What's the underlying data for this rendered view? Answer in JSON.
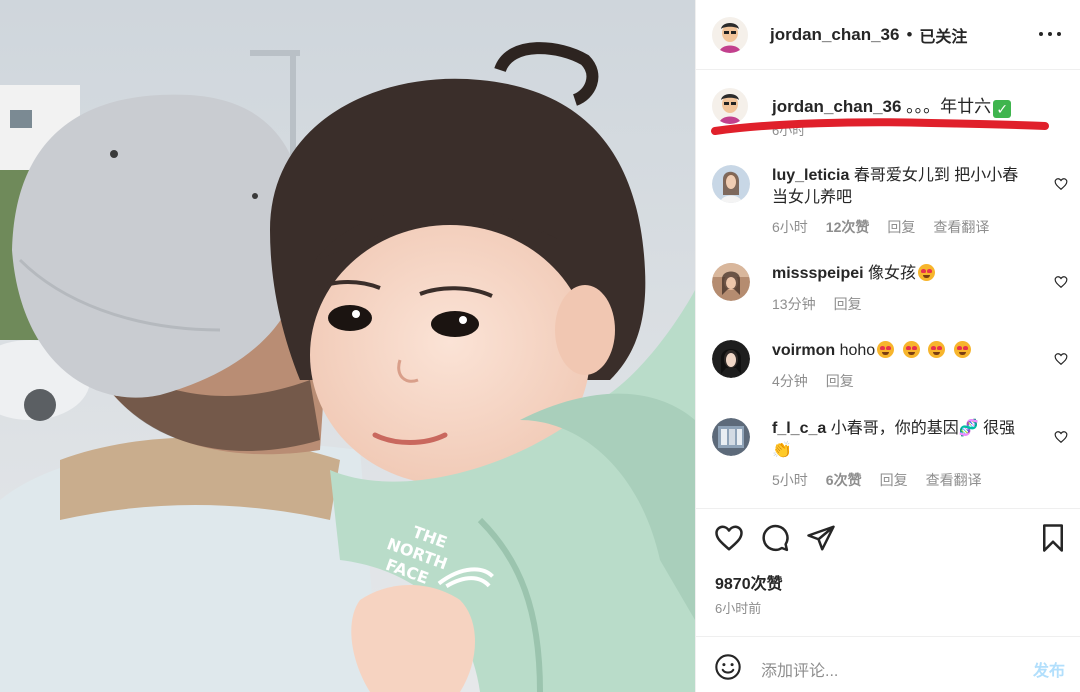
{
  "post": {
    "username": "jordan_chan_36",
    "separator": "•",
    "follow_status": "已关注",
    "more_icon": "more-horizontal-icon"
  },
  "caption": {
    "username": "jordan_chan_36",
    "text": " 。。。年廿六",
    "emoji": "check-mark-emoji",
    "time": "6小时"
  },
  "comments": [
    {
      "username": "luy_leticia",
      "text": " 春哥爱女儿到 把小小春当女儿养吧",
      "time": "6小时",
      "likes": "12次赞",
      "reply": "回复",
      "translate": "查看翻译"
    },
    {
      "username": "missspeipei",
      "text": " 像女孩",
      "time": "13分钟",
      "reply": "回复"
    },
    {
      "username": "voirmon",
      "text": " hoho",
      "time": "4分钟",
      "reply": "回复"
    },
    {
      "username": "f_l_c_a",
      "text": " 小春哥，你的基因",
      "text2": " 很强",
      "time": "5小时",
      "likes": "6次赞",
      "reply": "回复",
      "translate": "查看翻译"
    }
  ],
  "stats": {
    "likes": "9870次赞",
    "posted": "6小时前"
  },
  "add_comment": {
    "placeholder": "添加评论...",
    "post_label": "发布"
  },
  "colors": {
    "text": "#262626",
    "secondary": "#8e8e8e",
    "post_disabled": "#b2dffc",
    "underline_red": "#e0202b"
  }
}
